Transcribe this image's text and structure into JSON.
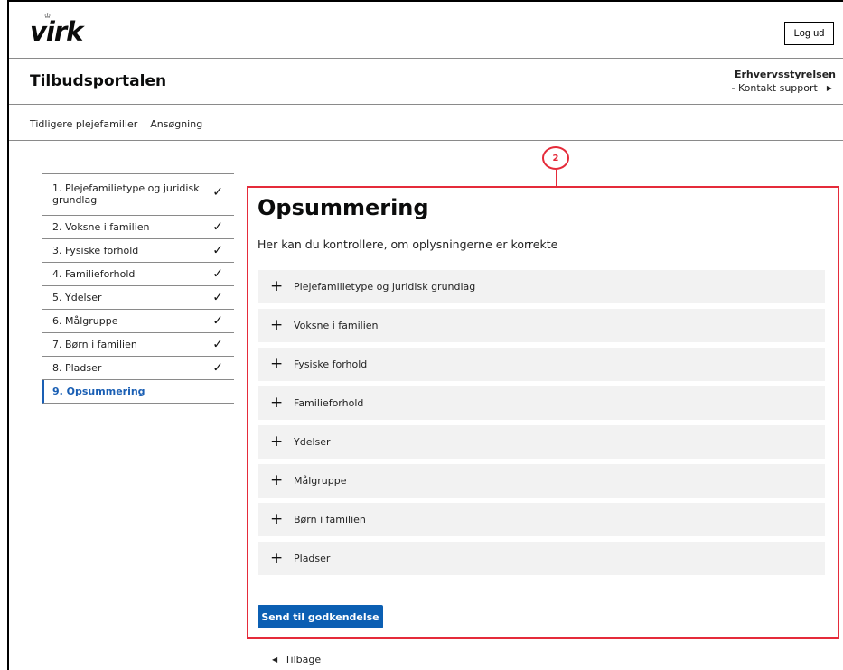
{
  "header": {
    "logo_text": "virk",
    "logout_label": "Log ud",
    "portal_title": "Tilbudsportalen",
    "org_name": "Erhvervsstyrelsen",
    "support_label": "- Kontakt support"
  },
  "topnav": [
    "Tidligere plejefamilier",
    "Ansøgning"
  ],
  "steps": [
    {
      "label": "1. Plejefamilietype og juridisk grundlag",
      "done": true
    },
    {
      "label": "2. Voksne i familien",
      "done": true
    },
    {
      "label": "3. Fysiske forhold",
      "done": true
    },
    {
      "label": "4. Familieforhold",
      "done": true
    },
    {
      "label": "5. Ydelser",
      "done": true
    },
    {
      "label": "6. Målgruppe",
      "done": true
    },
    {
      "label": "7. Børn i familien",
      "done": true
    },
    {
      "label": "8. Pladser",
      "done": true
    },
    {
      "label": "9. Opsummering",
      "done": false,
      "active": true
    }
  ],
  "annotation": {
    "number": "2",
    "color": "#e52b3a"
  },
  "main": {
    "heading": "Opsummering",
    "intro": "Her kan du kontrollere, om oplysningerne er korrekte",
    "sections": [
      "Plejefamilietype og juridisk grundlag",
      "Voksne i familien",
      "Fysiske forhold",
      "Familieforhold",
      "Ydelser",
      "Målgruppe",
      "Børn i familien",
      "Pladser"
    ],
    "submit_label": "Send til godkendelse",
    "back_label": "Tilbage"
  },
  "icons": {
    "check": "checkmark-icon",
    "plus": "plus-icon",
    "caret_right": "caret-right-icon",
    "caret_left": "caret-left-icon"
  },
  "colors": {
    "primary": "#0b5fb3",
    "active_step": "#1a5fb4",
    "accordion_bg": "#f2f2f2"
  }
}
